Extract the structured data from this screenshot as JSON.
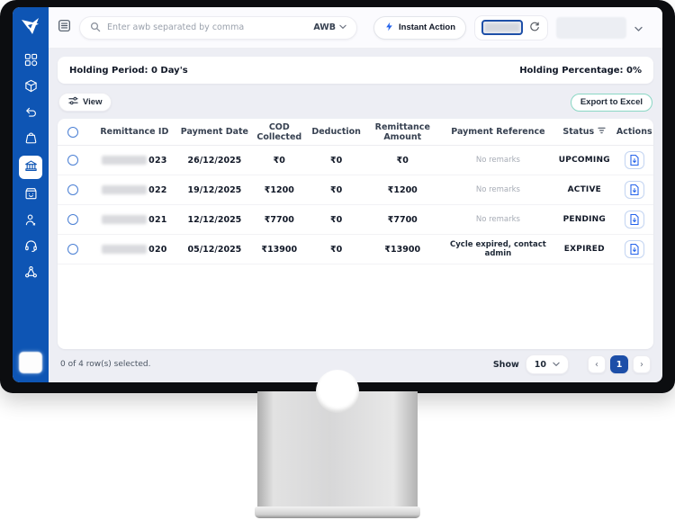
{
  "sidebar": {
    "color": "#0e55b4",
    "logo_icon": "brand-logo",
    "items": [
      {
        "icon": "dashboard-icon",
        "active": false
      },
      {
        "icon": "orders-package-icon",
        "active": false
      },
      {
        "icon": "returns-undo-icon",
        "active": false
      },
      {
        "icon": "weight-bag-icon",
        "active": false
      },
      {
        "icon": "remittance-bank-icon",
        "active": true
      },
      {
        "icon": "products-box-icon",
        "active": false
      },
      {
        "icon": "customers-person-icon",
        "active": false
      },
      {
        "icon": "support-headset-icon",
        "active": false
      },
      {
        "icon": "integrations-share-icon",
        "active": false
      }
    ]
  },
  "header": {
    "search": {
      "placeholder": "Enter awb separated by comma",
      "filter_label": "AWB"
    },
    "instant_action_label": "Instant Action",
    "wallet": {
      "balance_hidden": true,
      "refresh_icon": "refresh-icon"
    },
    "account": {
      "hidden": true,
      "chevron_icon": "chevron-down-icon"
    }
  },
  "holding_bar": {
    "period_text": "Holding Period: 0 Day's",
    "percentage_text": "Holding Percentage: 0%"
  },
  "toolbar": {
    "view_label": "View",
    "export_label": "Export to Excel",
    "export_border_color": "#8ad7c4"
  },
  "table": {
    "columns": [
      "Remittance ID",
      "Payment Date",
      "COD Collected",
      "Deduction",
      "Remittance Amount",
      "Payment Reference",
      "Status",
      "Actions"
    ],
    "status_filter_icon": "filter-icon",
    "rows": [
      {
        "id_suffix": "023",
        "payment_date": "26/12/2025",
        "cod_collected": "₹0",
        "deduction": "₹0",
        "remittance_amount": "₹0",
        "payment_reference": "No remarks",
        "status": "UPCOMING"
      },
      {
        "id_suffix": "022",
        "payment_date": "19/12/2025",
        "cod_collected": "₹1200",
        "deduction": "₹0",
        "remittance_amount": "₹1200",
        "payment_reference": "No remarks",
        "status": "ACTIVE"
      },
      {
        "id_suffix": "021",
        "payment_date": "12/12/2025",
        "cod_collected": "₹7700",
        "deduction": "₹0",
        "remittance_amount": "₹7700",
        "payment_reference": "No remarks",
        "status": "PENDING"
      },
      {
        "id_suffix": "020",
        "payment_date": "05/12/2025",
        "cod_collected": "₹13900",
        "deduction": "₹0",
        "remittance_amount": "₹13900",
        "payment_reference": "Cycle expired, contact admin",
        "status": "EXPIRED"
      }
    ]
  },
  "footer": {
    "selected_text": "0 of 4 row(s) selected.",
    "show_label": "Show",
    "page_size": "10",
    "prev_label": "‹",
    "current_page": "1",
    "next_label": "›"
  },
  "colors": {
    "sidebar_blue": "#0e55b4",
    "action_blue": "#2563eb",
    "pager_active": "#1d4fa8"
  }
}
